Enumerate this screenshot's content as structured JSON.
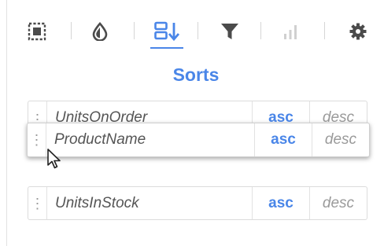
{
  "toolbar": {
    "buttons": [
      {
        "name": "select-icon"
      },
      {
        "name": "color-drop-icon"
      },
      {
        "name": "sort-icon",
        "active": true
      },
      {
        "name": "filter-icon"
      },
      {
        "name": "bar-chart-icon",
        "disabled": true
      },
      {
        "name": "gear-icon"
      }
    ],
    "accent_color": "#4a86e8"
  },
  "sorts": {
    "title": "Sorts",
    "rows": [
      {
        "field": "UnitsOnOrder",
        "asc_label": "asc",
        "desc_label": "desc",
        "selected": "asc"
      },
      {
        "field": "ProductName",
        "asc_label": "asc",
        "desc_label": "desc",
        "selected": "asc",
        "state": "dragging"
      },
      {
        "field": "UnitsInStock",
        "asc_label": "asc",
        "desc_label": "desc",
        "selected": "asc"
      }
    ]
  },
  "handle_glyph": "⋮"
}
